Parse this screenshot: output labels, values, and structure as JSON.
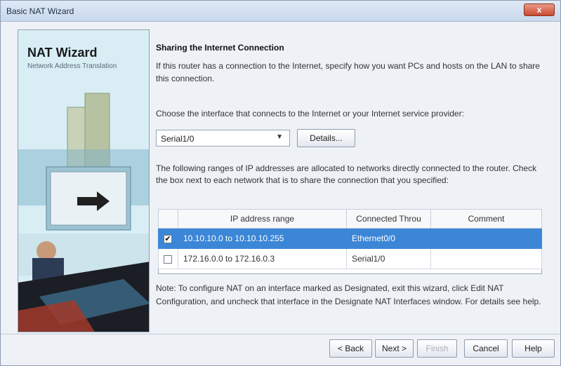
{
  "window": {
    "title": "Basic NAT Wizard",
    "close_label": "x"
  },
  "banner": {
    "title": "NAT Wizard",
    "subtitle": "Network Address Translation"
  },
  "content": {
    "heading": "Sharing the Internet Connection",
    "intro": "If this router has a connection to the Internet, specify how you want PCs and hosts on the LAN to share this connection.",
    "choose_prompt": "Choose the interface that connects to the Internet or your Internet service provider:",
    "interface_select": {
      "value": "Serial1/0"
    },
    "details_label": "Details...",
    "ranges_prompt": "The following ranges of IP addresses are allocated to networks directly connected to the router. Check the box next to each network that is to share the connection that you specified:",
    "table": {
      "headers": [
        "",
        "IP address range",
        "Connected Throu",
        "Comment"
      ],
      "rows": [
        {
          "checked": true,
          "range": "10.10.10.0 to 10.10.10.255",
          "connected": "Ethernet0/0",
          "comment": ""
        },
        {
          "checked": false,
          "range": "172.16.0.0 to 172.16.0.3",
          "connected": "Serial1/0",
          "comment": ""
        }
      ]
    },
    "note": "Note: To configure NAT on an interface marked as Designated, exit this wizard, click Edit NAT Configuration, and uncheck that interface in the Designate NAT Interfaces window. For details see help."
  },
  "footer": {
    "back_label": "< Back",
    "next_label": "Next >",
    "finish_label": "Finish",
    "cancel_label": "Cancel",
    "help_label": "Help"
  },
  "colors": {
    "selection": "#3b86d6",
    "close_button": "#c84a32"
  }
}
